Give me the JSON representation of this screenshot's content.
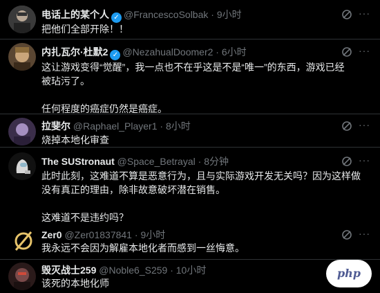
{
  "tweets": [
    {
      "name": "电话上的某个人",
      "verified": true,
      "handle": "@FrancescoSolbak",
      "sep": "·",
      "time": "9小时",
      "lines": [
        "把他们全部开除！！"
      ],
      "avatar_color": "#6b6b6b"
    },
    {
      "name": "内扎瓦尔·杜默2",
      "verified": true,
      "handle": "@NezahualDoomer2",
      "sep": "·",
      "time": "6小时",
      "lines": [
        "这让游戏变得“觉醒”，我一点也不在乎这是不是“唯一”的东西，游戏已经被玷污了。",
        "",
        "任何程度的癌症仍然是癌症。"
      ],
      "avatar_color": "#7a5a3a"
    },
    {
      "name": "拉斐尔",
      "verified": false,
      "handle": "@Raphael_Player1",
      "sep": "·",
      "time": "8小时",
      "lines": [
        "烧掉本地化审查"
      ],
      "avatar_color": "#5a4a6a"
    },
    {
      "name": "The SUStronaut",
      "verified": false,
      "handle": "@Space_Betrayal",
      "sep": "·",
      "time": "8分钟",
      "lines": [
        "此时此刻，这难道不算是恶意行为，且与实际游戏开发无关吗？因为这样做没有真正的理由，除非故意破坏潜在销售。",
        "",
        "这难道不是违约吗？"
      ],
      "avatar_color": "#2a2a2a"
    },
    {
      "name": "Zer0",
      "verified": false,
      "handle": "@Zer01837841",
      "sep": "·",
      "time": "9小时",
      "lines": [
        "我永远不会因为解雇本地化者而感到一丝悔意。"
      ],
      "avatar_color": "#000000"
    },
    {
      "name": "毁灭战士259",
      "verified": false,
      "handle": "@Noble6_S259",
      "sep": "·",
      "time": "10小时",
      "lines": [
        "该死的本地化师"
      ],
      "avatar_color": "#4a2a2a"
    }
  ],
  "more_label": "···",
  "watermark": "php",
  "icons": {
    "verified": "verified-badge-icon",
    "grok": "grok-icon",
    "more": "more-options-icon",
    "empty_set_avatar": "∅"
  },
  "colors": {
    "background": "#000000",
    "text": "#e7e9ea",
    "secondary": "#71767b",
    "verified": "#1d9bf0",
    "divider": "#2f3336"
  }
}
